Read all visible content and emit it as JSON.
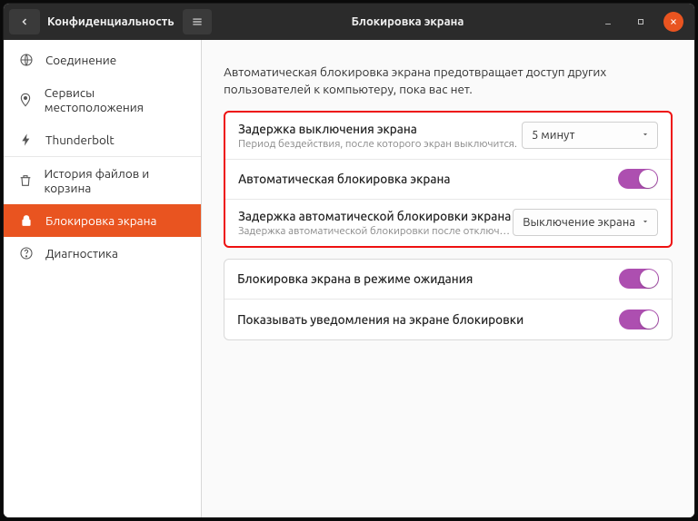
{
  "titlebar": {
    "left_title": "Конфиденциальность",
    "right_title": "Блокировка экрана"
  },
  "sidebar": {
    "items": [
      {
        "label": "Соединение"
      },
      {
        "label": "Сервисы местоположения"
      },
      {
        "label": "Thunderbolt"
      },
      {
        "label": "История файлов и корзина"
      },
      {
        "label": "Блокировка экрана"
      },
      {
        "label": "Диагностика"
      }
    ]
  },
  "content": {
    "description": "Автоматическая блокировка экрана предотвращает доступ других пользователей к компьютеру, пока вас нет.",
    "rows": {
      "blank_delay": {
        "title": "Задержка выключения экрана",
        "sub": "Период бездействия, после которого экран выключится.",
        "value": "5 минут"
      },
      "auto_lock": {
        "title": "Автоматическая блокировка экрана"
      },
      "auto_lock_delay": {
        "title": "Задержка автоматической блокировки экрана",
        "sub": "Задержка автоматической блокировки после отключен…",
        "value": "Выключение экрана"
      },
      "suspend_lock": {
        "title": "Блокировка экрана в режиме ожидания"
      },
      "notifications": {
        "title": "Показывать уведомления на экране блокировки"
      }
    }
  }
}
